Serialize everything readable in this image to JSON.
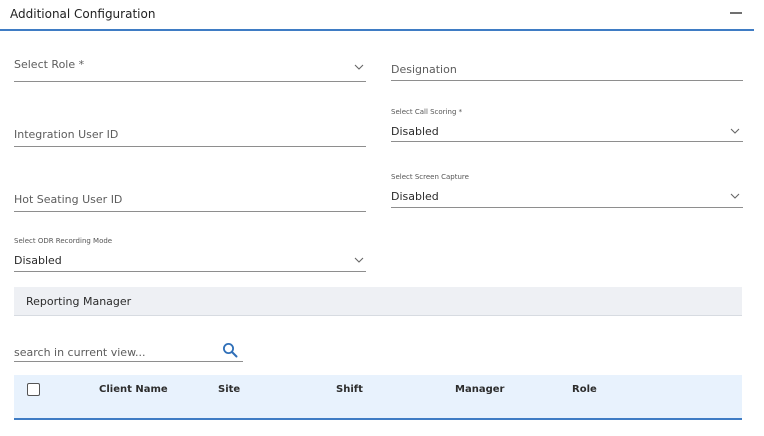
{
  "section": {
    "title": "Additional Configuration",
    "collapse_icon": "minus-icon"
  },
  "form": {
    "select_role": {
      "placeholder": "Select Role *"
    },
    "designation": {
      "placeholder": "Designation"
    },
    "integration_user_id": {
      "placeholder": "Integration User ID"
    },
    "call_scoring": {
      "label": "Select Call Scoring *",
      "value": "Disabled"
    },
    "hot_seating_user_id": {
      "placeholder": "Hot Seating User ID"
    },
    "screen_capture": {
      "label": "Select Screen Capture",
      "value": "Disabled"
    },
    "odr_recording_mode": {
      "label": "Select ODR Recording Mode",
      "value": "Disabled"
    }
  },
  "reporting_manager": {
    "title": "Reporting Manager",
    "search": {
      "placeholder": "search in current view...",
      "icon": "search-icon"
    },
    "columns": [
      "Client Name",
      "Site",
      "Shift",
      "Manager",
      "Role"
    ]
  },
  "colors": {
    "accent": "#3f7cc4",
    "table_header_bg": "#e8f2fd",
    "section_bar_bg": "#eef0f4"
  }
}
